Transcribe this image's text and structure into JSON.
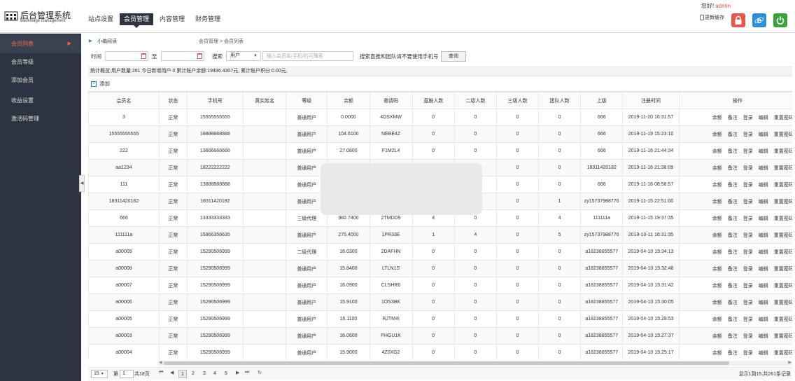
{
  "app": {
    "title": "后台管理系统",
    "subtitle": "Backstage management"
  },
  "nav": [
    "站点设置",
    "会员管理",
    "内容管理",
    "财务管理"
  ],
  "header": {
    "greeting": "您好!",
    "user": "admin",
    "cache": "更新缓存"
  },
  "sidebar": {
    "items": [
      "会员列表",
      "会员等级",
      "添加会员",
      "收益设置",
      "激活码管理"
    ]
  },
  "breadcrumb": {
    "read": "小编阅读",
    "path": "会员管理 > 会员列表"
  },
  "filter": {
    "time_label": "时间",
    "to_label": "至",
    "search_label": "搜索",
    "select_value": "用户",
    "input_placeholder": "输入会员名/手机/约可搜索",
    "hint": "搜索直推和团队请不要使用手机号",
    "query_button": "查询"
  },
  "stats": "统计概览:用户数量:261  今日新增用户 0   累计账户余额:19486.4307元,   累计账户积分:0.00元,",
  "add_label": "添加",
  "table": {
    "headers": [
      "会员名",
      "状态",
      "手机号",
      "真实姓名",
      "等级",
      "余额",
      "邀请码",
      "直推人数",
      "二级人数",
      "三级人数",
      "团队人数",
      "上级",
      "注册时间",
      "操作"
    ],
    "ops": [
      "余额",
      "备注",
      "登录",
      "编辑",
      "重置密码"
    ],
    "rows": [
      [
        "3",
        "正常",
        "15555555555",
        "",
        "普通用户",
        "0.0000",
        "4DSXMW",
        "0",
        "0",
        "0",
        "0",
        "666",
        "2019-11-20 16:31:57"
      ],
      [
        "15555555555",
        "正常",
        "18888888888",
        "",
        "普通用户",
        "104.6100",
        "NEBE4Z",
        "0",
        "0",
        "0",
        "0",
        "666",
        "2019-11-19 15:23:10"
      ],
      [
        "222",
        "正常",
        "13666666666",
        "",
        "普通用户",
        "27.0800",
        "F1M2L4",
        "0",
        "0",
        "0",
        "0",
        "666",
        "2019-11-16 21:44:34"
      ],
      [
        "aa1234",
        "正常",
        "18222222222",
        "",
        "普通用户",
        "",
        "",
        "",
        "",
        "0",
        "0",
        "18311420182",
        "2019-11-16 21:38:09"
      ],
      [
        "111",
        "正常",
        "13888888888",
        "",
        "普通用户",
        "",
        "",
        "",
        "",
        "0",
        "0",
        "666",
        "2019-11-16 08:58:57"
      ],
      [
        "18311420182",
        "正常",
        "18311420182",
        "",
        "普通用户",
        "",
        "",
        "",
        "",
        "0",
        "1",
        "zy15737988776",
        "2019-11-15 22:51:00"
      ],
      [
        "666",
        "正常",
        "13333333333",
        "",
        "三级代理",
        "982.7400",
        "2TMDD9",
        "4",
        "0",
        "0",
        "4",
        "111111a",
        "2019-11-15 19:37:35"
      ],
      [
        "111111a",
        "正常",
        "15966356635",
        "",
        "普通用户",
        "275.4000",
        "1PR33E",
        "1",
        "4",
        "0",
        "5",
        "zy15737988776",
        "2019-10-11 16:31:35"
      ],
      [
        "a00009",
        "正常",
        "15290506999",
        "",
        "二级代理",
        "16.0300",
        "2DAFHN",
        "0",
        "0",
        "0",
        "0",
        "a18238855577",
        "2019-04-10 15:34:13"
      ],
      [
        "a00008",
        "正常",
        "15290506999",
        "",
        "普通用户",
        "15.8400",
        "LTLN1S",
        "0",
        "0",
        "0",
        "0",
        "a18238855577",
        "2019-04-10 15:32:48"
      ],
      [
        "a00007",
        "正常",
        "15290506999",
        "",
        "普通用户",
        "16.0900",
        "CLSHR0",
        "0",
        "0",
        "0",
        "0",
        "a18238855577",
        "2019-04-10 15:31:42"
      ],
      [
        "a00006",
        "正常",
        "15290506999",
        "",
        "普通用户",
        "15.9100",
        "1OS3BK",
        "0",
        "0",
        "0",
        "0",
        "a18238855577",
        "2019-04-10 15:30:05"
      ],
      [
        "a00005",
        "正常",
        "15290506999",
        "",
        "普通用户",
        "16.1100",
        "RJTM4I",
        "0",
        "0",
        "0",
        "0",
        "a18238855577",
        "2019-04-10 15:28:53"
      ],
      [
        "a00003",
        "正常",
        "15290506999",
        "",
        "普通用户",
        "16.0600",
        "PHGU1K",
        "0",
        "0",
        "0",
        "0",
        "a18238855577",
        "2019-04-10 15:27:37"
      ],
      [
        "a00004",
        "正常",
        "15290506999",
        "",
        "普通用户",
        "15.9000",
        "4Z0XG2",
        "0",
        "0",
        "0",
        "0",
        "a18238855577",
        "2019-04-10 15:25:17"
      ]
    ]
  },
  "pager": {
    "size": "15",
    "page_prefix": "第",
    "page_value": "1",
    "total_pages": "共18页",
    "pages": [
      "1",
      "2",
      "3",
      "4",
      "5"
    ],
    "info": "显示1到15,共261条记录"
  },
  "colors": {
    "sidebar": "#2d3440",
    "accent": "#f56a5a",
    "lock": "#e8574d",
    "ie": "#2a8fd6",
    "power": "#3aa13d"
  }
}
